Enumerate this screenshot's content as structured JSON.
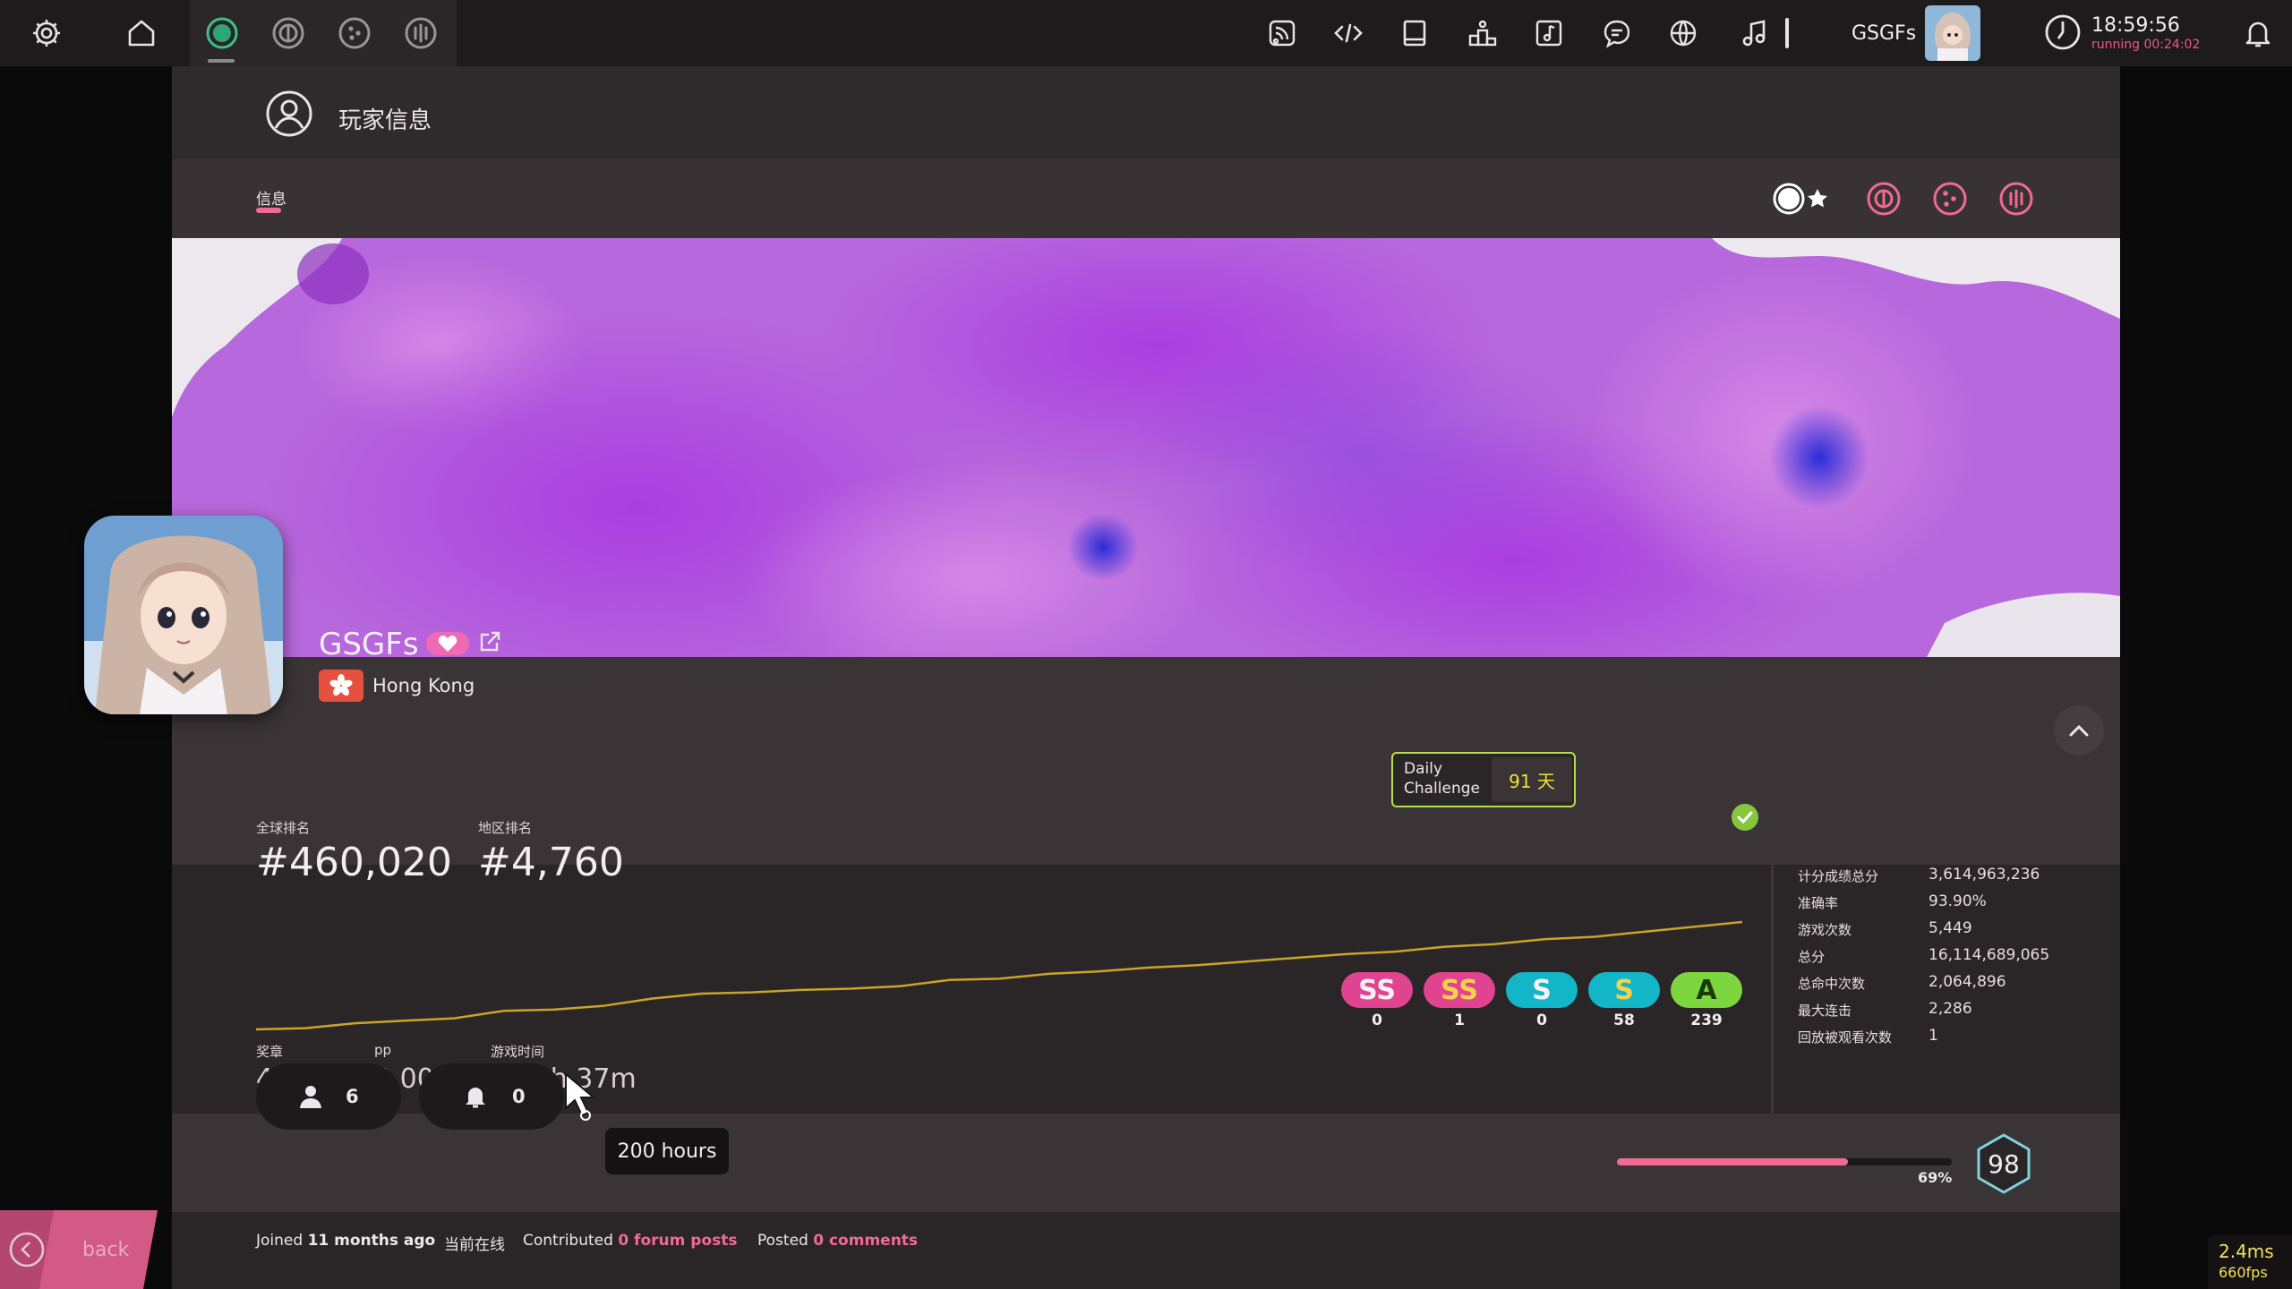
{
  "toolbar": {
    "icons": [
      "settings-icon",
      "home-icon",
      "ruleset-osu-icon",
      "ruleset-taiko-icon",
      "ruleset-catch-icon",
      "ruleset-mania-icon",
      "news-icon",
      "changelog-icon",
      "wiki-icon",
      "rankings-icon",
      "beatmap-listing-icon",
      "chat-icon",
      "dashboard-icon",
      "now-playing-icon"
    ],
    "username": "GSGFs",
    "clock_time": "18:59:56",
    "clock_running": "running 00:24:02"
  },
  "overlay": {
    "title": "玩家信息",
    "tab_info": "信息"
  },
  "profile": {
    "username": "GSGFs",
    "country": "Hong Kong",
    "global_rank_label": "全球排名",
    "global_rank": "#460,020",
    "country_rank_label": "地区排名",
    "country_rank": "#4,760",
    "medals_label": "奖章",
    "medals": "46",
    "pp_label": "pp",
    "pp": "2,000",
    "playtime_label": "游戏时间",
    "playtime": "8d 8h 37m",
    "tooltip": "200 hours"
  },
  "daily_challenge": {
    "label_line1": "Daily",
    "label_line2": "Challenge",
    "value": "91 天"
  },
  "rank_history": [
    691,
    690,
    686,
    684,
    682,
    676,
    675,
    672,
    666,
    662,
    661,
    659,
    658,
    656,
    651,
    650,
    646,
    644,
    641,
    639,
    636,
    633,
    630,
    628,
    624,
    622,
    618,
    616,
    612,
    608,
    604
  ],
  "grades": [
    {
      "label": "SS",
      "count": "0",
      "bg": "#e0438f",
      "fg": "#f6f2f4",
      "name": "grade-ss-silver"
    },
    {
      "label": "SS",
      "count": "1",
      "bg": "#e0438f",
      "fg": "#f6d24c",
      "name": "grade-ss"
    },
    {
      "label": "S",
      "count": "0",
      "bg": "#13b6c6",
      "fg": "#f6f2f4",
      "name": "grade-s-silver"
    },
    {
      "label": "S",
      "count": "58",
      "bg": "#13b6c6",
      "fg": "#f6d24c",
      "name": "grade-s"
    },
    {
      "label": "A",
      "count": "239",
      "bg": "#7ed63f",
      "fg": "#1a3b12",
      "name": "grade-a"
    }
  ],
  "stats": [
    {
      "label": "计分成绩总分",
      "value": "3,614,963,236"
    },
    {
      "label": "准确率",
      "value": "93.90%"
    },
    {
      "label": "游戏次数",
      "value": "5,449"
    },
    {
      "label": "总分",
      "value": "16,114,689,065"
    },
    {
      "label": "总命中次数",
      "value": "2,064,896"
    },
    {
      "label": "最大连击",
      "value": "2,286"
    },
    {
      "label": "回放被观看次数",
      "value": "1"
    }
  ],
  "social": {
    "followers": "6",
    "mapping_subscribers": "0"
  },
  "level": {
    "progress_percent": 69,
    "progress_label": "69%",
    "value": "98"
  },
  "footer": {
    "joined_prefix": "Joined ",
    "joined_value": "11 months ago",
    "online_status": "当前在线",
    "contributed_prefix": "Contributed ",
    "forum_posts": "0 forum posts",
    "posted_prefix": "Posted ",
    "comments": "0 comments"
  },
  "back_label": "back",
  "fps": {
    "ms": "2.4ms",
    "fps": "660fps"
  },
  "colors": {
    "accent_pink": "#f06a95",
    "daily_border": "#b5e04a",
    "graph_line": "#c9a42a"
  }
}
